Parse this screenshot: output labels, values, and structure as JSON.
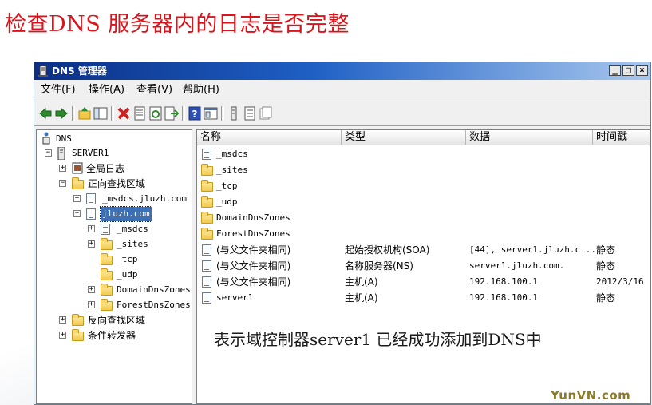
{
  "slide": {
    "title": "检查DNS 服务器内的日志是否完整",
    "caption": "表示域控制器server1 已经成功添加到DNS中",
    "watermark": "YunVN.com"
  },
  "window": {
    "title": "DNS 管理器",
    "controls": [
      "_",
      "□",
      "×"
    ]
  },
  "menu": [
    "文件(F)",
    "操作(A)",
    "查看(V)",
    "帮助(H)"
  ],
  "toolbar": {
    "icons": [
      "back-icon",
      "forward-icon",
      "up-level-icon",
      "show-tree-icon",
      "delete-icon",
      "properties-icon",
      "refresh-icon",
      "export-list-icon",
      "help-icon",
      "console-icon",
      "resource-record-icon",
      "list-view-icon",
      "detail-view-icon"
    ]
  },
  "tree": {
    "root": "DNS",
    "server": "SERVER1",
    "global_logs": "全局日志",
    "forward_zones": "正向查找区域",
    "msdcs_zone": "_msdcs.jluzh.com",
    "jluzh_zone": "jluzh.com",
    "children": [
      "_msdcs",
      "_sites",
      "_tcp",
      "_udp",
      "DomainDnsZones",
      "ForestDnsZones"
    ],
    "reverse_zones": "反向查找区域",
    "conditional_forwarders": "条件转发器"
  },
  "list": {
    "columns": [
      "名称",
      "类型",
      "数据",
      "时间戳"
    ],
    "folders": [
      "_msdcs",
      "_sites",
      "_tcp",
      "_udp",
      "DomainDnsZones",
      "ForestDnsZones"
    ],
    "records": [
      {
        "name": "(与父文件夹相同)",
        "type": "起始授权机构(SOA)",
        "data": "[44], server1.jluzh.c...",
        "timestamp": "静态"
      },
      {
        "name": "(与父文件夹相同)",
        "type": "名称服务器(NS)",
        "data": "server1.jluzh.com.",
        "timestamp": "静态"
      },
      {
        "name": "(与父文件夹相同)",
        "type": "主机(A)",
        "data": "192.168.100.1",
        "timestamp": "2012/3/16"
      },
      {
        "name": "server1",
        "type": "主机(A)",
        "data": "192.168.100.1",
        "timestamp": "静态"
      }
    ]
  }
}
